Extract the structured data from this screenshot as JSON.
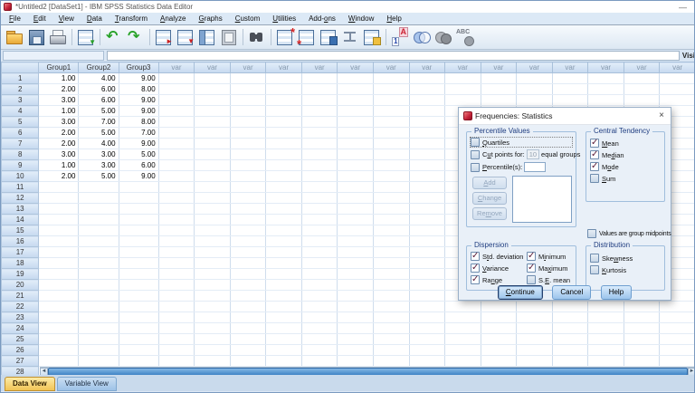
{
  "window": {
    "title": "*Untitled2 [DataSet1] - IBM SPSS Statistics Data Editor",
    "app_icon": "spss-red-icon",
    "minimize_glyph": "—"
  },
  "menu": {
    "items": [
      {
        "text": "File",
        "u": 0
      },
      {
        "text": "Edit",
        "u": 0
      },
      {
        "text": "View",
        "u": 0
      },
      {
        "text": "Data",
        "u": 0
      },
      {
        "text": "Transform",
        "u": 0
      },
      {
        "text": "Analyze",
        "u": 0
      },
      {
        "text": "Graphs",
        "u": 0
      },
      {
        "text": "Custom",
        "u": 0
      },
      {
        "text": "Utilities",
        "u": 0
      },
      {
        "text": "Add-ons",
        "u": 4
      },
      {
        "text": "Window",
        "u": 0
      },
      {
        "text": "Help",
        "u": 0
      }
    ]
  },
  "toolbar": {
    "icons": [
      {
        "name": "open-data-icon",
        "style": "i-folder",
        "sep": false
      },
      {
        "name": "save-icon",
        "style": "i-floppy",
        "sep": false
      },
      {
        "name": "print-icon",
        "style": "i-printer",
        "sep": true
      },
      {
        "name": "recall-dialogs-icon",
        "style": "gridic i-recall",
        "sep": true
      },
      {
        "name": "undo-icon",
        "style": "i-undo",
        "sep": false
      },
      {
        "name": "redo-icon",
        "style": "i-redo",
        "sep": true
      },
      {
        "name": "go-to-case-icon",
        "style": "gridic i-gotocase",
        "sep": false
      },
      {
        "name": "go-to-variable-icon",
        "style": "gridic i-gotovar",
        "sep": false
      },
      {
        "name": "variables-icon",
        "style": "gridic i-vars",
        "sep": false
      },
      {
        "name": "variables-window-icon",
        "style": "i-panel",
        "sep": true
      },
      {
        "name": "find-icon",
        "style": "i-find",
        "sep": true
      },
      {
        "name": "insert-cases-icon",
        "style": "gridic i-inscase",
        "sep": false
      },
      {
        "name": "insert-variable-icon",
        "style": "gridic i-insvar",
        "sep": false
      },
      {
        "name": "split-file-icon",
        "style": "gridic i-split",
        "sep": false
      },
      {
        "name": "weight-cases-icon",
        "style": "i-weight",
        "sep": false
      },
      {
        "name": "select-cases-icon",
        "style": "gridic i-select",
        "sep": true
      },
      {
        "name": "value-labels-icon",
        "style": "i-vallabels",
        "sep": false
      },
      {
        "name": "use-variable-sets-icon",
        "style": "i-venn",
        "sep": false
      },
      {
        "name": "show-all-variables-icon",
        "style": "i-circles",
        "sep": false
      },
      {
        "name": "spell-check-icon",
        "style": "i-abc",
        "sep": false
      }
    ]
  },
  "formula_bar": {
    "cell_ref": "",
    "value": "",
    "visible_label": "Visi"
  },
  "grid": {
    "columns": [
      "Group1",
      "Group2",
      "Group3"
    ],
    "var_placeholder": "var",
    "var_columns": 15,
    "visible_rows": 28,
    "rows": [
      [
        "1.00",
        "4.00",
        "9.00"
      ],
      [
        "2.00",
        "6.00",
        "8.00"
      ],
      [
        "3.00",
        "6.00",
        "9.00"
      ],
      [
        "1.00",
        "5.00",
        "9.00"
      ],
      [
        "3.00",
        "7.00",
        "8.00"
      ],
      [
        "2.00",
        "5.00",
        "7.00"
      ],
      [
        "2.00",
        "4.00",
        "9.00"
      ],
      [
        "3.00",
        "3.00",
        "5.00"
      ],
      [
        "1.00",
        "3.00",
        "6.00"
      ],
      [
        "2.00",
        "5.00",
        "9.00"
      ]
    ]
  },
  "tabs": [
    {
      "label": "Data View",
      "active": true
    },
    {
      "label": "Variable View",
      "active": false
    }
  ],
  "dialog": {
    "title": "Frequencies: Statistics",
    "close_glyph": "×",
    "percentile_values": {
      "label": "Percentile Values",
      "quartiles": {
        "text": "Quartiles",
        "u": 0,
        "checked": false
      },
      "cut_points": {
        "text": "Cut points for:",
        "u": 1,
        "checked": false
      },
      "cut_points_value": "10",
      "equal_groups_label": "equal groups",
      "percentiles": {
        "text": "Percentile(s):",
        "u": 0,
        "checked": false
      },
      "percentiles_value": "",
      "add": {
        "text": "Add",
        "u": 0
      },
      "change": {
        "text": "Change",
        "u": 0
      },
      "remove": {
        "text": "Remove",
        "u": 2
      }
    },
    "central_tendency": {
      "label": "Central Tendency",
      "items": [
        {
          "text": "Mean",
          "u": 0,
          "checked": true
        },
        {
          "text": "Median",
          "u": 2,
          "checked": true
        },
        {
          "text": "Mode",
          "u": 1,
          "checked": true
        },
        {
          "text": "Sum",
          "u": 0,
          "checked": false
        }
      ]
    },
    "values_group_midpoints": {
      "text": "Values are group midpoints",
      "u": -1,
      "checked": false
    },
    "dispersion": {
      "label": "Dispersion",
      "items": [
        {
          "text": "Std. deviation",
          "u": 1,
          "checked": true
        },
        {
          "text": "Variance",
          "u": 0,
          "checked": true
        },
        {
          "text": "Range",
          "u": 2,
          "checked": true
        },
        {
          "text": "Minimum",
          "u": 1,
          "checked": true
        },
        {
          "text": "Maximum",
          "u": 2,
          "checked": true
        },
        {
          "text": "S.E. mean",
          "u": 2,
          "checked": false
        }
      ]
    },
    "distribution": {
      "label": "Distribution",
      "items": [
        {
          "text": "Skewness",
          "u": 3,
          "checked": false
        },
        {
          "text": "Kurtosis",
          "u": 0,
          "checked": false
        }
      ]
    },
    "buttons": {
      "continue": {
        "text": "Continue",
        "u": 0
      },
      "cancel": {
        "text": "Cancel",
        "u": -1
      },
      "help": {
        "text": "Help",
        "u": -1
      }
    }
  },
  "colors": {
    "checkmark": "#5a1b36",
    "dialog_bg": "#e9f0f8",
    "grid_header_bg": "#c6d9ef",
    "active_tab": "#f1c455",
    "scrollbar_thumb": "#3f84c6",
    "group_label_text": "#1f3d80"
  }
}
